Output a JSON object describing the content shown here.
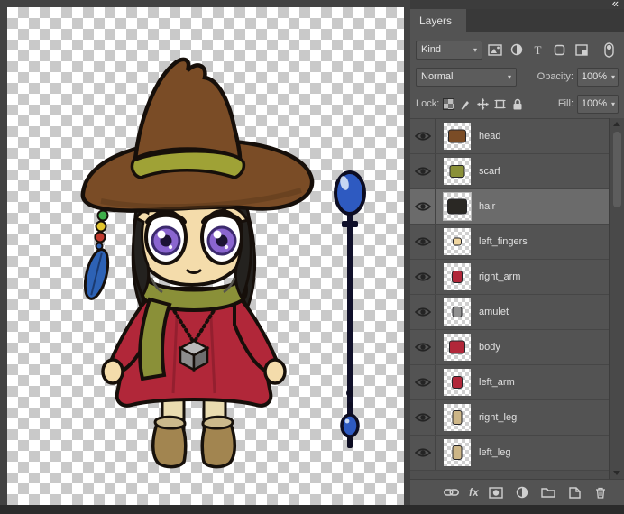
{
  "window": {
    "collapse_glyph": "«"
  },
  "ui": {
    "dropdown_chevron": "▾"
  },
  "layers_panel": {
    "tab_label": "Layers",
    "kind": {
      "label": "Kind",
      "filter_icons": [
        "pixel-layer-filter-icon",
        "adjustment-layer-filter-icon",
        "type-layer-filter-icon",
        "shape-layer-filter-icon",
        "smart-object-filter-icon"
      ],
      "toggle_icon": "layer-filter-toggle"
    },
    "blend": {
      "mode": "Normal",
      "opacity_label": "Opacity:",
      "opacity_value": "100%"
    },
    "lock": {
      "label": "Lock:",
      "icons": [
        "lock-transparent-icon",
        "lock-pixels-icon",
        "lock-position-icon",
        "lock-artboard-icon",
        "lock-all-icon"
      ],
      "fill_label": "Fill:",
      "fill_value": "100%"
    },
    "layers": [
      {
        "name": "head",
        "selected": false,
        "thumb_color": "#7a4c26",
        "thumb_w": 18,
        "thumb_h": 13
      },
      {
        "name": "scarf",
        "selected": false,
        "thumb_color": "#8a9038",
        "thumb_w": 15,
        "thumb_h": 12
      },
      {
        "name": "hair",
        "selected": true,
        "thumb_color": "#2a2824",
        "thumb_w": 20,
        "thumb_h": 15
      },
      {
        "name": "left_fingers",
        "selected": false,
        "thumb_color": "#f0d6a0",
        "thumb_w": 8,
        "thumb_h": 7
      },
      {
        "name": "right_arm",
        "selected": false,
        "thumb_color": "#b12739",
        "thumb_w": 10,
        "thumb_h": 12
      },
      {
        "name": "amulet",
        "selected": false,
        "thumb_color": "#909090",
        "thumb_w": 9,
        "thumb_h": 10
      },
      {
        "name": "body",
        "selected": false,
        "thumb_color": "#b12739",
        "thumb_w": 16,
        "thumb_h": 13
      },
      {
        "name": "left_arm",
        "selected": false,
        "thumb_color": "#b12739",
        "thumb_w": 10,
        "thumb_h": 12
      },
      {
        "name": "right_leg",
        "selected": false,
        "thumb_color": "#cdb687",
        "thumb_w": 9,
        "thumb_h": 14
      },
      {
        "name": "left_leg",
        "selected": false,
        "thumb_color": "#cdb687",
        "thumb_w": 9,
        "thumb_h": 14
      }
    ],
    "bottom_bar": {
      "fx_label": "fx",
      "icons": [
        "link-layers-icon",
        "layer-style-icon",
        "layer-mask-icon",
        "adjustment-layer-icon",
        "layer-group-icon",
        "new-layer-icon",
        "delete-layer-icon"
      ]
    }
  },
  "colors": {
    "panel_bg": "#535353",
    "selected_row": "#6b6b6b",
    "checker_light": "#ffffff",
    "checker_dark": "#c9c9c9",
    "dress_red": "#b12739",
    "orb_blue": "#2e5ac1",
    "hat_brown": "#7a4c26",
    "scarf_olive": "#8a9038",
    "eye_purple": "#8a65cf"
  }
}
